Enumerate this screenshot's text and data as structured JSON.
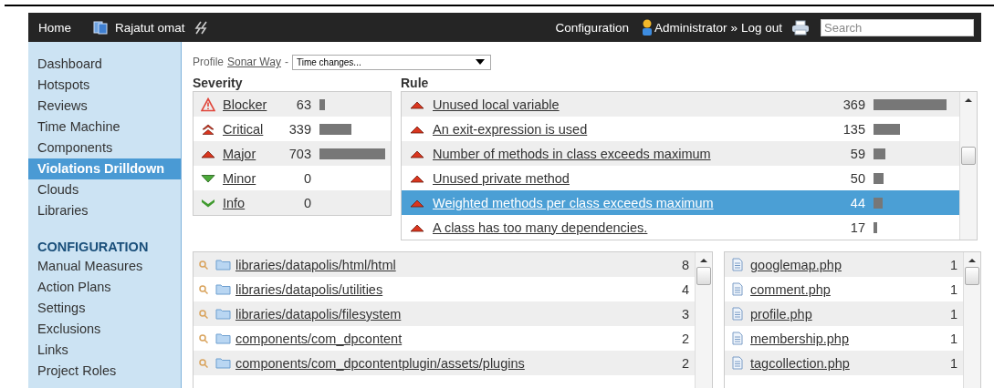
{
  "topbar": {
    "home": "Home",
    "project": "Rajatut omat",
    "configuration": "Configuration",
    "user": "Administrator",
    "separator": "»",
    "logout": "Log out",
    "search": {
      "placeholder": "Search"
    }
  },
  "sidebar": {
    "sections": [
      {
        "items": [
          {
            "label": "Dashboard",
            "selected": false
          },
          {
            "label": "Hotspots",
            "selected": false
          },
          {
            "label": "Reviews",
            "selected": false
          },
          {
            "label": "Time Machine",
            "selected": false
          },
          {
            "label": "Components",
            "selected": false
          },
          {
            "label": "Violations Drilldown",
            "selected": true
          },
          {
            "label": "Clouds",
            "selected": false
          },
          {
            "label": "Libraries",
            "selected": false
          }
        ]
      },
      {
        "heading": "CONFIGURATION",
        "items": [
          {
            "label": "Manual Measures",
            "selected": false
          },
          {
            "label": "Action Plans",
            "selected": false
          },
          {
            "label": "Settings",
            "selected": false
          },
          {
            "label": "Exclusions",
            "selected": false
          },
          {
            "label": "Links",
            "selected": false
          },
          {
            "label": "Project Roles",
            "selected": false
          }
        ]
      }
    ]
  },
  "filter": {
    "label": "Profile",
    "profile": "Sonar Way",
    "separator": "-",
    "period": "Time changes..."
  },
  "severity": {
    "heading": "Severity",
    "rows": [
      {
        "kind": "blocker",
        "label": "Blocker",
        "count": "63"
      },
      {
        "kind": "critical",
        "label": "Critical",
        "count": "339"
      },
      {
        "kind": "major",
        "label": "Major",
        "count": "703"
      },
      {
        "kind": "minor",
        "label": "Minor",
        "count": "0"
      },
      {
        "kind": "info",
        "label": "Info",
        "count": "0"
      }
    ]
  },
  "rules": {
    "heading": "Rule",
    "rows": [
      {
        "kind": "major",
        "label": "Unused local variable",
        "count": "369",
        "selected": false
      },
      {
        "kind": "major",
        "label": "An exit-expression is used",
        "count": "135",
        "selected": false
      },
      {
        "kind": "major",
        "label": "Number of methods in class exceeds maximum",
        "count": "59",
        "selected": false
      },
      {
        "kind": "major",
        "label": "Unused private method",
        "count": "50",
        "selected": false
      },
      {
        "kind": "major",
        "label": "Weighted methods per class exceeds maximum",
        "count": "44",
        "selected": true
      },
      {
        "kind": "major",
        "label": "A class has too many dependencies.",
        "count": "17",
        "selected": false
      }
    ]
  },
  "directories": {
    "rows": [
      {
        "path": "libraries/datapolis/html/html",
        "count": "8"
      },
      {
        "path": "libraries/datapolis/utilities",
        "count": "4"
      },
      {
        "path": "libraries/datapolis/filesystem",
        "count": "3"
      },
      {
        "path": "components/com_dpcontent",
        "count": "2"
      },
      {
        "path": "components/com_dpcontentplugin/assets/plugins",
        "count": "2"
      }
    ]
  },
  "files": {
    "rows": [
      {
        "name": "googlemap.php",
        "count": "1"
      },
      {
        "name": "comment.php",
        "count": "1"
      },
      {
        "name": "profile.php",
        "count": "1"
      },
      {
        "name": "membership.php",
        "count": "1"
      },
      {
        "name": "tagcollection.php",
        "count": "1"
      }
    ]
  }
}
